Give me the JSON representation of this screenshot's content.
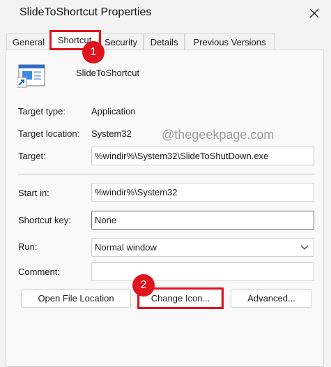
{
  "window": {
    "title": "SlideToShortcut Properties",
    "close_icon": "close-icon"
  },
  "tabs": [
    {
      "label": "General"
    },
    {
      "label": "Shortcut"
    },
    {
      "label": "Security"
    },
    {
      "label": "Details"
    },
    {
      "label": "Previous Versions"
    }
  ],
  "active_tab": "Shortcut",
  "shortcut": {
    "icon": "shortcut-app-icon",
    "name": "SlideToShortcut",
    "target_type_label": "Target type:",
    "target_type_value": "Application",
    "target_location_label": "Target location:",
    "target_location_value": "System32",
    "target_label": "Target:",
    "target_value": "%windir%\\System32\\SlideToShutDown.exe",
    "start_in_label": "Start in:",
    "start_in_value": "%windir%\\System32",
    "shortcut_key_label": "Shortcut key:",
    "shortcut_key_value": "None",
    "run_label": "Run:",
    "run_value": "Normal window",
    "comment_label": "Comment:",
    "comment_value": ""
  },
  "buttons": {
    "open_file_location": "Open File Location",
    "change_icon": "Change Icon...",
    "advanced": "Advanced..."
  },
  "annotations": {
    "step1": "1",
    "step2": "2",
    "highlight_color": "#e0141e"
  },
  "watermark": "@thegeekpage.com"
}
